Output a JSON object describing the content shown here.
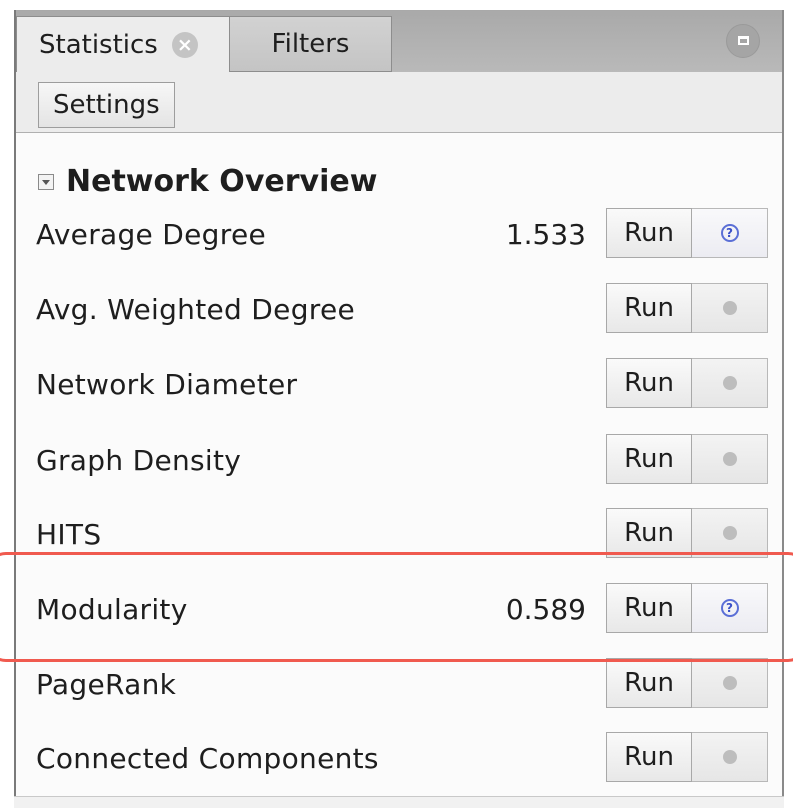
{
  "tabs": [
    {
      "label": "Statistics",
      "close_icon": "x-circle-icon"
    },
    {
      "label": "Filters"
    }
  ],
  "toolbar": {
    "settings_label": "Settings",
    "minimize_icon": "minimize-icon"
  },
  "section": {
    "title": "Network Overview",
    "collapse_icon": "collapse-arrow-icon"
  },
  "rows": [
    {
      "label": "Average Degree",
      "value": "1.533",
      "run_label": "Run",
      "help_icon": "help-question-icon"
    },
    {
      "label": "Avg. Weighted Degree",
      "value": "",
      "run_label": "Run",
      "help_icon": "disabled-dot-icon"
    },
    {
      "label": "Network Diameter",
      "value": "",
      "run_label": "Run",
      "help_icon": "disabled-dot-icon"
    },
    {
      "label": "Graph Density",
      "value": "",
      "run_label": "Run",
      "help_icon": "disabled-dot-icon"
    },
    {
      "label": "HITS",
      "value": "",
      "run_label": "Run",
      "help_icon": "disabled-dot-icon"
    },
    {
      "label": "Modularity",
      "value": "0.589",
      "run_label": "Run",
      "help_icon": "help-question-icon"
    },
    {
      "label": "PageRank",
      "value": "",
      "run_label": "Run",
      "help_icon": "disabled-dot-icon"
    },
    {
      "label": "Connected Components",
      "value": "",
      "run_label": "Run",
      "help_icon": "disabled-dot-icon"
    }
  ],
  "colors": {
    "highlight": "#f05a4f",
    "help_icon": "#3a50c8"
  }
}
